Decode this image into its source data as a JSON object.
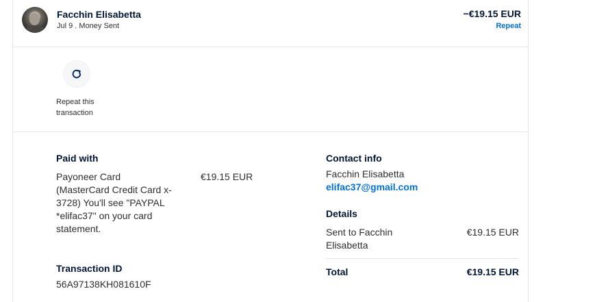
{
  "header": {
    "name": "Facchin Elisabetta",
    "subline": "Jul 9 . Money Sent",
    "amount": "−€19.15 EUR",
    "repeat_link": "Repeat"
  },
  "actions": {
    "repeat_icon": "refresh-icon",
    "repeat_caption": "Repeat this transaction"
  },
  "paid_with": {
    "title": "Paid with",
    "description": "Payoneer Card (MasterCard Credit Card x-3728) You'll see \"PAYPAL *elifac37\" on your card statement.",
    "amount": "€19.15 EUR"
  },
  "transaction": {
    "title": "Transaction ID",
    "id": "56A97138KH081610F"
  },
  "contact": {
    "title": "Contact info",
    "name": "Facchin Elisabetta",
    "email": "elifac37@gmail.com"
  },
  "details": {
    "title": "Details",
    "sent_to": "Sent to Facchin Elisabetta",
    "sent_amount": "€19.15 EUR",
    "total_label": "Total",
    "total_amount": "€19.15 EUR"
  },
  "colors": {
    "link": "#0070e0",
    "heading": "#001435",
    "text": "#2c2e2f"
  }
}
